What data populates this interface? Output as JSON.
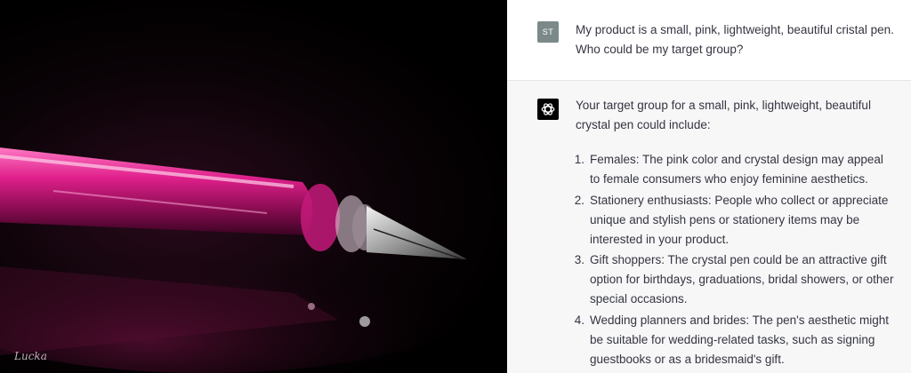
{
  "image_panel": {
    "signature": "Lucka"
  },
  "chat": {
    "user": {
      "avatar": "ST",
      "message": "My product is a small, pink, lightweight, beautiful cristal pen. Who could be my target group?"
    },
    "assistant": {
      "avatar_icon": "openai-logo-icon",
      "intro": "Your target group for a small, pink, lightweight, beautiful crystal pen could include:",
      "items": [
        {
          "num": "1.",
          "text": "Females: The pink color and crystal design may appeal to female consumers who enjoy feminine aesthetics."
        },
        {
          "num": "2.",
          "text": "Stationery enthusiasts: People who collect or appreciate unique and stylish pens or stationery items may be interested in your product."
        },
        {
          "num": "3.",
          "text": "Gift shoppers: The crystal pen could be an attractive gift option for birthdays, graduations, bridal showers, or other special occasions."
        },
        {
          "num": "4.",
          "text": "Wedding planners and brides: The pen's aesthetic might be suitable for wedding-related tasks, such as signing guestbooks or as a bridesmaid's gift."
        }
      ]
    }
  },
  "colors": {
    "user_avatar": "#7b8a89",
    "assistant_bg": "#f7f7f8",
    "text": "#343541",
    "pen_pink": "#e0208c"
  }
}
